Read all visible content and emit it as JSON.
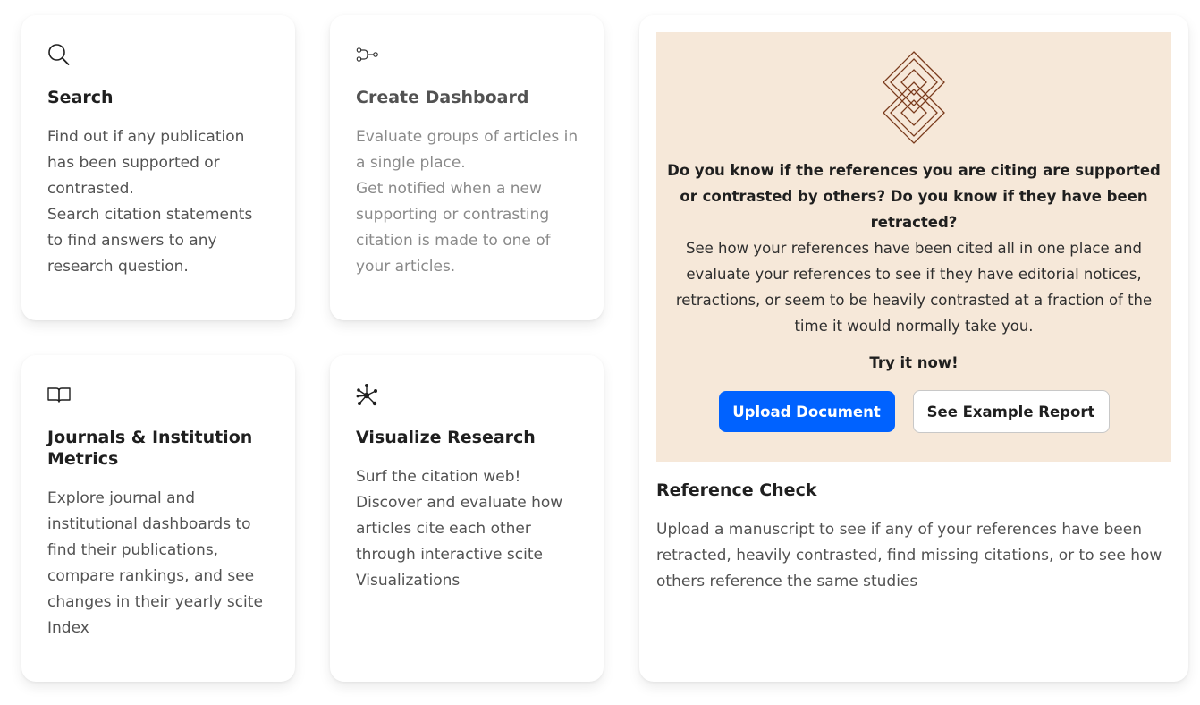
{
  "cards": {
    "search": {
      "icon": "search-icon",
      "title": "Search",
      "description": "Find out if any publication has been supported or contrasted.\nSearch citation statements to find answers to any research question."
    },
    "dashboard": {
      "icon": "dashboard-nodes-icon",
      "title": "Create Dashboard",
      "description": "Evaluate groups of articles in a single place.\nGet notified when a new supporting or contrasting citation is made to one of your articles."
    },
    "journals": {
      "icon": "open-book-icon",
      "title": "Journals & Institution Metrics",
      "description": "Explore journal and institutional dashboards to find their publications, compare rankings, and see changes in their yearly scite Index"
    },
    "visualize": {
      "icon": "network-graph-icon",
      "title": "Visualize Research",
      "description": "Surf the citation web! Discover and evaluate how articles cite each other through interactive scite Visualizations"
    }
  },
  "reference_check": {
    "logo": "scite-logo",
    "question": "Do you know if the references you are citing are supported or contrasted by others? Do you know if they have been retracted?",
    "body": "See how your references have been cited all in one place and evaluate your references to see if they have editorial notices, retractions, or seem to be heavily contrasted at a fraction of the time it would normally take you.",
    "cta": "Try it now!",
    "upload_label": "Upload Document",
    "example_label": "See Example Report",
    "title": "Reference Check",
    "description": "Upload a manuscript to see if any of your references have been retracted, heavily contrasted, find missing citations, or to see how others reference the same studies"
  },
  "colors": {
    "primary": "#0062ff",
    "promo_bg": "#f6e8d9",
    "logo_stroke": "#7a3b1d"
  }
}
